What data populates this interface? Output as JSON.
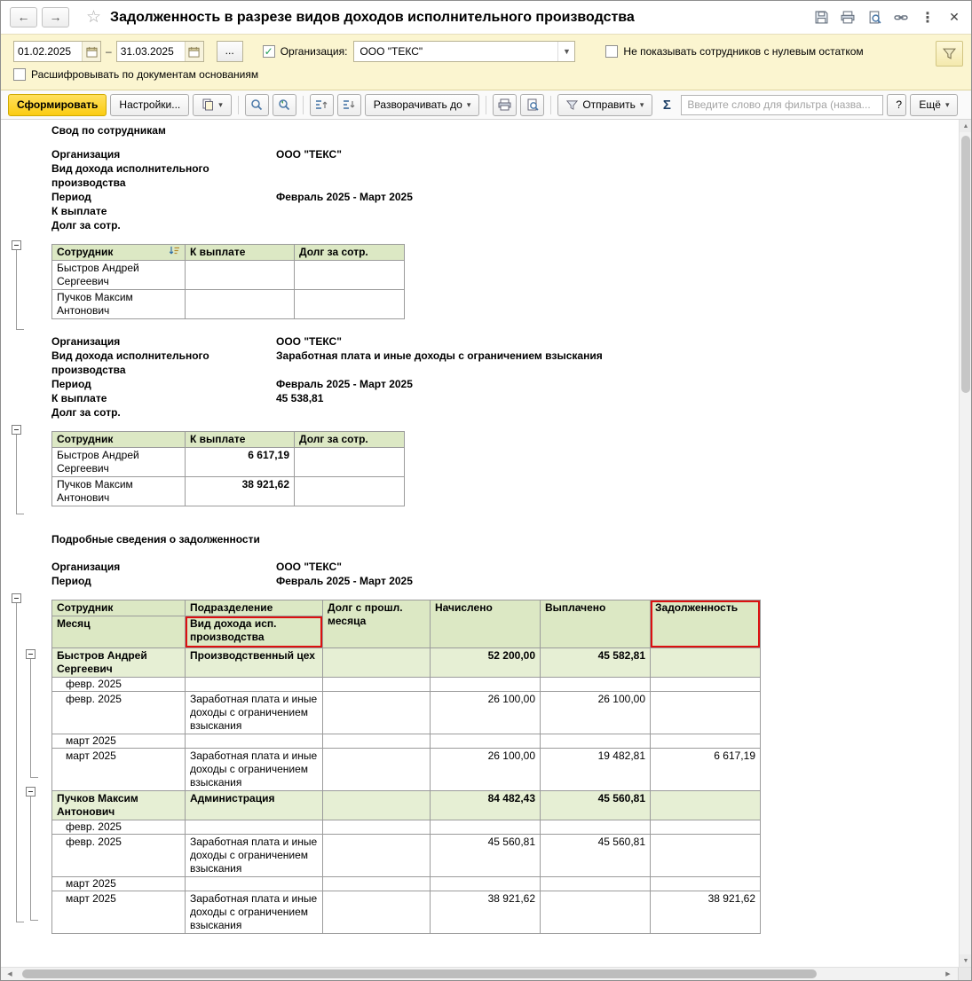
{
  "window": {
    "title": "Задолженность в разрезе видов доходов исполнительного производства"
  },
  "filter_panel": {
    "date_from": "01.02.2025",
    "date_separator": "–",
    "date_to": "31.03.2025",
    "more_dates_button": "...",
    "organization_label": "Организация:",
    "organization_value": "ООО \"ТЕКС\"",
    "hide_zero_label": "Не показывать сотрудников с нулевым остатком",
    "explain_by_docs_label": "Расшифровывать по документам основаниям",
    "org_checked": "✓"
  },
  "toolbar": {
    "generate_button": "Сформировать",
    "settings_button": "Настройки...",
    "expand_to_button": "Разворачивать до",
    "send_button": "Отправить",
    "sigma_button": "Σ",
    "filter_input_placeholder": "Введите слово для фильтра (назва...",
    "help_button": "?",
    "more_button": "Ещё",
    "dropdown_arrow": "▾"
  },
  "report": {
    "summary_title": "Свод по сотрудникам",
    "details_title": "Подробные сведения о задолженности",
    "labels": {
      "organization": "Организация",
      "income_type": "Вид дохода исполнительного производства",
      "period": "Период",
      "to_pay": "К выплате",
      "employee_debt": "Долг за сотр."
    },
    "block1": {
      "organization": "ООО \"ТЕКС\"",
      "income_type": "",
      "period": "Февраль 2025 - Март 2025",
      "to_pay": "",
      "employee_debt": ""
    },
    "block2": {
      "organization": "ООО \"ТЕКС\"",
      "income_type": "Заработная плата и иные доходы с ограничением взыскания",
      "period": "Февраль 2025 - Март 2025",
      "to_pay": "45 538,81",
      "employee_debt": ""
    },
    "block3": {
      "organization": "ООО \"ТЕКС\"",
      "period": "Февраль 2025 - Март 2025"
    },
    "summary_headers": [
      "Сотрудник",
      "К выплате",
      "Долг за сотр."
    ],
    "table1_rows": [
      {
        "employee": "Быстров Андрей Сергеевич",
        "to_pay": "",
        "employee_debt": ""
      },
      {
        "employee": "Пучков Максим Антонович",
        "to_pay": "",
        "employee_debt": ""
      }
    ],
    "table2_rows": [
      {
        "employee": "Быстров Андрей Сергеевич",
        "to_pay": "6 617,19",
        "employee_debt": ""
      },
      {
        "employee": "Пучков Максим Антонович",
        "to_pay": "38 921,62",
        "employee_debt": ""
      }
    ],
    "detail_headers": {
      "employee": "Сотрудник",
      "month": "Месяц",
      "department": "Подразделение",
      "income_type": "Вид дохода исп. производства",
      "prev_month_debt": "Долг с прошл. месяца",
      "accrued": "Начислено",
      "paid": "Выплачено",
      "debt": "Задолженность"
    },
    "detail_rows": [
      {
        "type": "group",
        "c1": "Быстров Андрей Сергеевич",
        "c2": "Производственный цех",
        "c3": "",
        "c4": "52 200,00",
        "c5": "45 582,81",
        "c6": ""
      },
      {
        "type": "month",
        "c1": "февр. 2025",
        "c2": "",
        "c3": "",
        "c4": "",
        "c5": "",
        "c6": ""
      },
      {
        "type": "detail",
        "c1": "февр. 2025",
        "c2": "Заработная плата и иные доходы с ограничением взыскания",
        "c3": "",
        "c4": "26 100,00",
        "c5": "26 100,00",
        "c6": ""
      },
      {
        "type": "month",
        "c1": "март 2025",
        "c2": "",
        "c3": "",
        "c4": "",
        "c5": "",
        "c6": ""
      },
      {
        "type": "detail",
        "c1": "март 2025",
        "c2": "Заработная плата и иные доходы с ограничением взыскания",
        "c3": "",
        "c4": "26 100,00",
        "c5": "19 482,81",
        "c6": "6 617,19"
      },
      {
        "type": "group",
        "c1": "Пучков Максим Антонович",
        "c2": "Администрация",
        "c3": "",
        "c4": "84 482,43",
        "c5": "45 560,81",
        "c6": ""
      },
      {
        "type": "month",
        "c1": "февр. 2025",
        "c2": "",
        "c3": "",
        "c4": "",
        "c5": "",
        "c6": ""
      },
      {
        "type": "detail",
        "c1": "февр. 2025",
        "c2": "Заработная плата и иные доходы с ограничением взыскания",
        "c3": "",
        "c4": "45 560,81",
        "c5": "45 560,81",
        "c6": ""
      },
      {
        "type": "month",
        "c1": "март 2025",
        "c2": "",
        "c3": "",
        "c4": "",
        "c5": "",
        "c6": ""
      },
      {
        "type": "detail",
        "c1": "март 2025",
        "c2": "Заработная плата и иные доходы с ограничением взыскания",
        "c3": "",
        "c4": "38 921,62",
        "c5": "",
        "c6": "38 921,62"
      }
    ]
  },
  "colors": {
    "panel_yellow": "#fbf5d0",
    "generate_yellow": "#fbcc12",
    "table_header_green": "#dce8c4",
    "group_row_green": "#e6efd4",
    "highlight_red": "#dc1010"
  }
}
